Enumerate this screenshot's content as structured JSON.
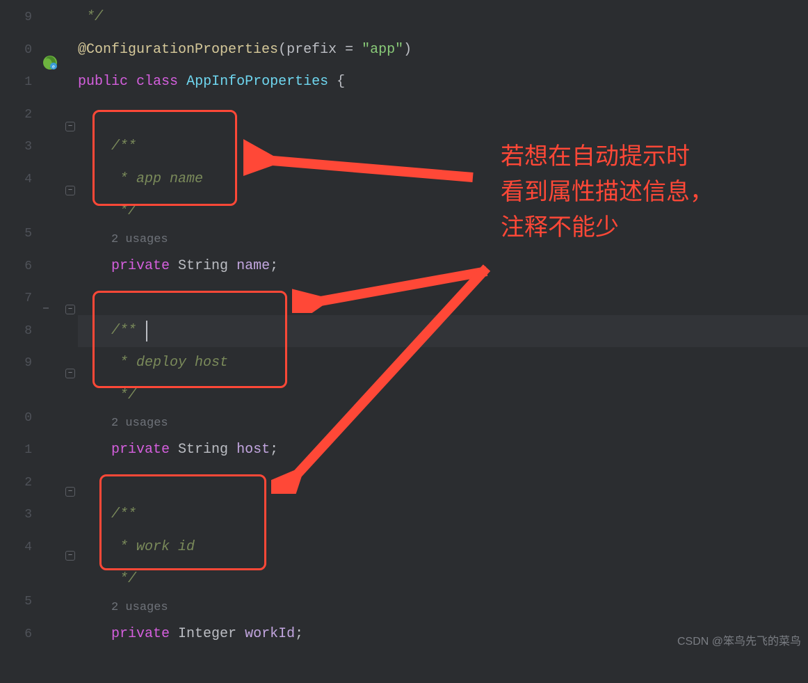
{
  "gutter": {
    "lines": [
      "9",
      "0",
      "1",
      "2",
      "3",
      "4",
      "",
      "5",
      "6",
      "7",
      "8",
      "9",
      "",
      "0",
      "1",
      "2",
      "3",
      "4",
      "",
      "5",
      "6"
    ]
  },
  "code": {
    "l0_end": "*/",
    "l1_annot": "@ConfigurationProperties",
    "l1_open": "(",
    "l1_prefix": "prefix",
    "l1_eq": " = ",
    "l1_str": "\"app\"",
    "l1_close": ")",
    "l2_public": "public",
    "l2_class": "class",
    "l2_name": "AppInfoProperties",
    "l2_brace": " {",
    "doc_open": "/**",
    "doc_app": " * app name",
    "doc_host": " * deploy host",
    "doc_work": " * work id",
    "doc_close": " */",
    "usages": "2 usages",
    "private": "private",
    "type_string": "String",
    "type_integer": "Integer",
    "field_name": "name",
    "field_host": "host",
    "field_work": "workId",
    "semi": ";"
  },
  "annotation": {
    "line1": "若想在自动提示时",
    "line2": "看到属性描述信息，",
    "line3": "注释不能少"
  },
  "watermark": "CSDN @笨鸟先飞的菜鸟"
}
